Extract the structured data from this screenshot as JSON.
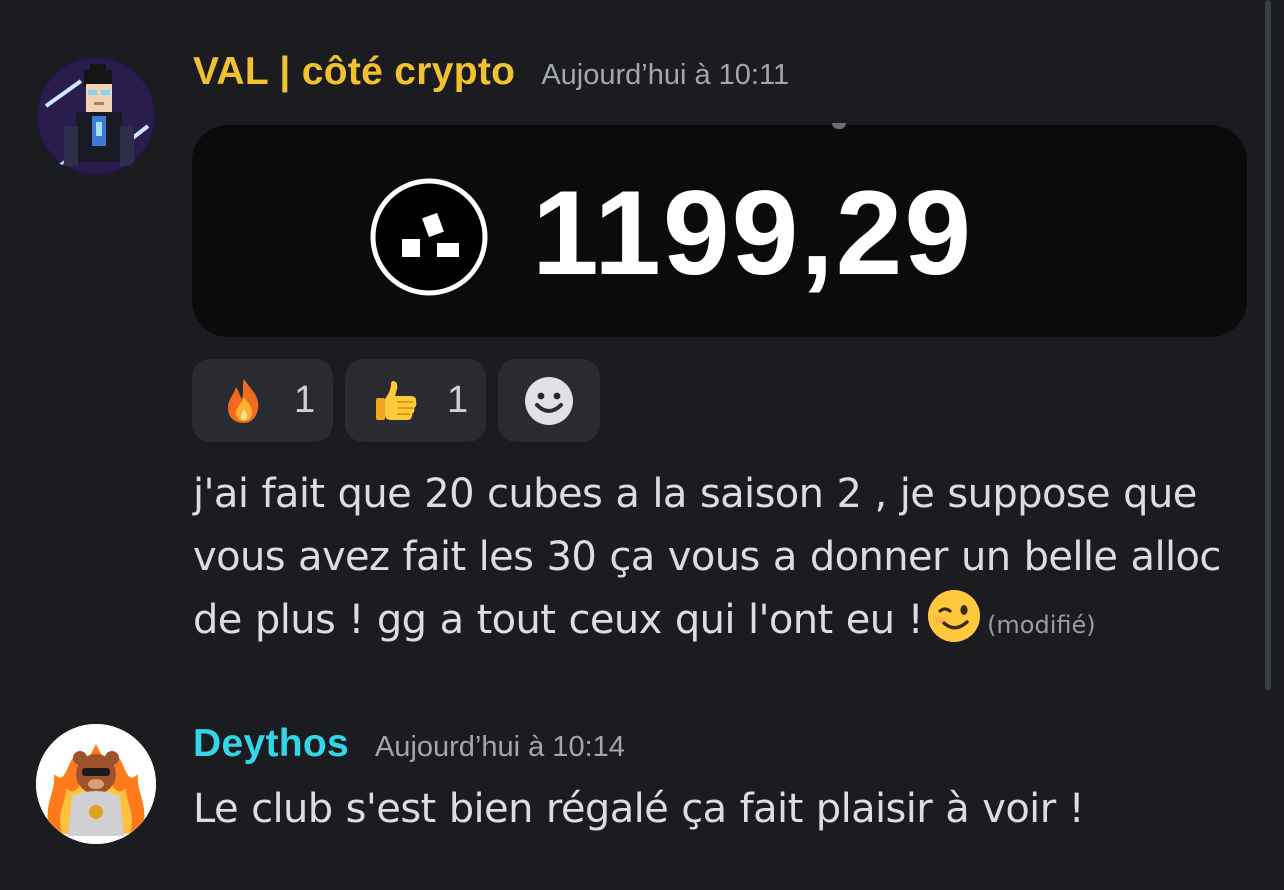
{
  "messages": [
    {
      "username": "VAL | côté crypto",
      "username_color": "#f1c12f",
      "timestamp": "Aujourd’hui à 10:11",
      "avatar": "pixel-art-avatar",
      "embed": {
        "logo": "coin-logo-icon",
        "amount": "1199,29"
      },
      "reactions": [
        {
          "emoji": "fire-emoji-icon",
          "count": "1"
        },
        {
          "emoji": "thumbs-up-emoji-icon",
          "count": "1"
        }
      ],
      "add_reaction_icon": "smiley-add-reaction-icon",
      "text_lines": [
        "j'ai fait que 20 cubes a la saison 2 , je suppose que",
        "vous avez fait les 30 ça vous a donner un belle alloc",
        "de plus !  gg a tout ceux qui l'ont eu !"
      ],
      "text_emoji": "wink-emoji-icon",
      "edited_label": "(modifié)"
    },
    {
      "username": "Deythos",
      "username_color": "#33d6e8",
      "timestamp": "Aujourd’hui à 10:14",
      "avatar": "bear-avatar",
      "text": "Le club s'est bien régalé ça fait plaisir à voir !"
    }
  ]
}
